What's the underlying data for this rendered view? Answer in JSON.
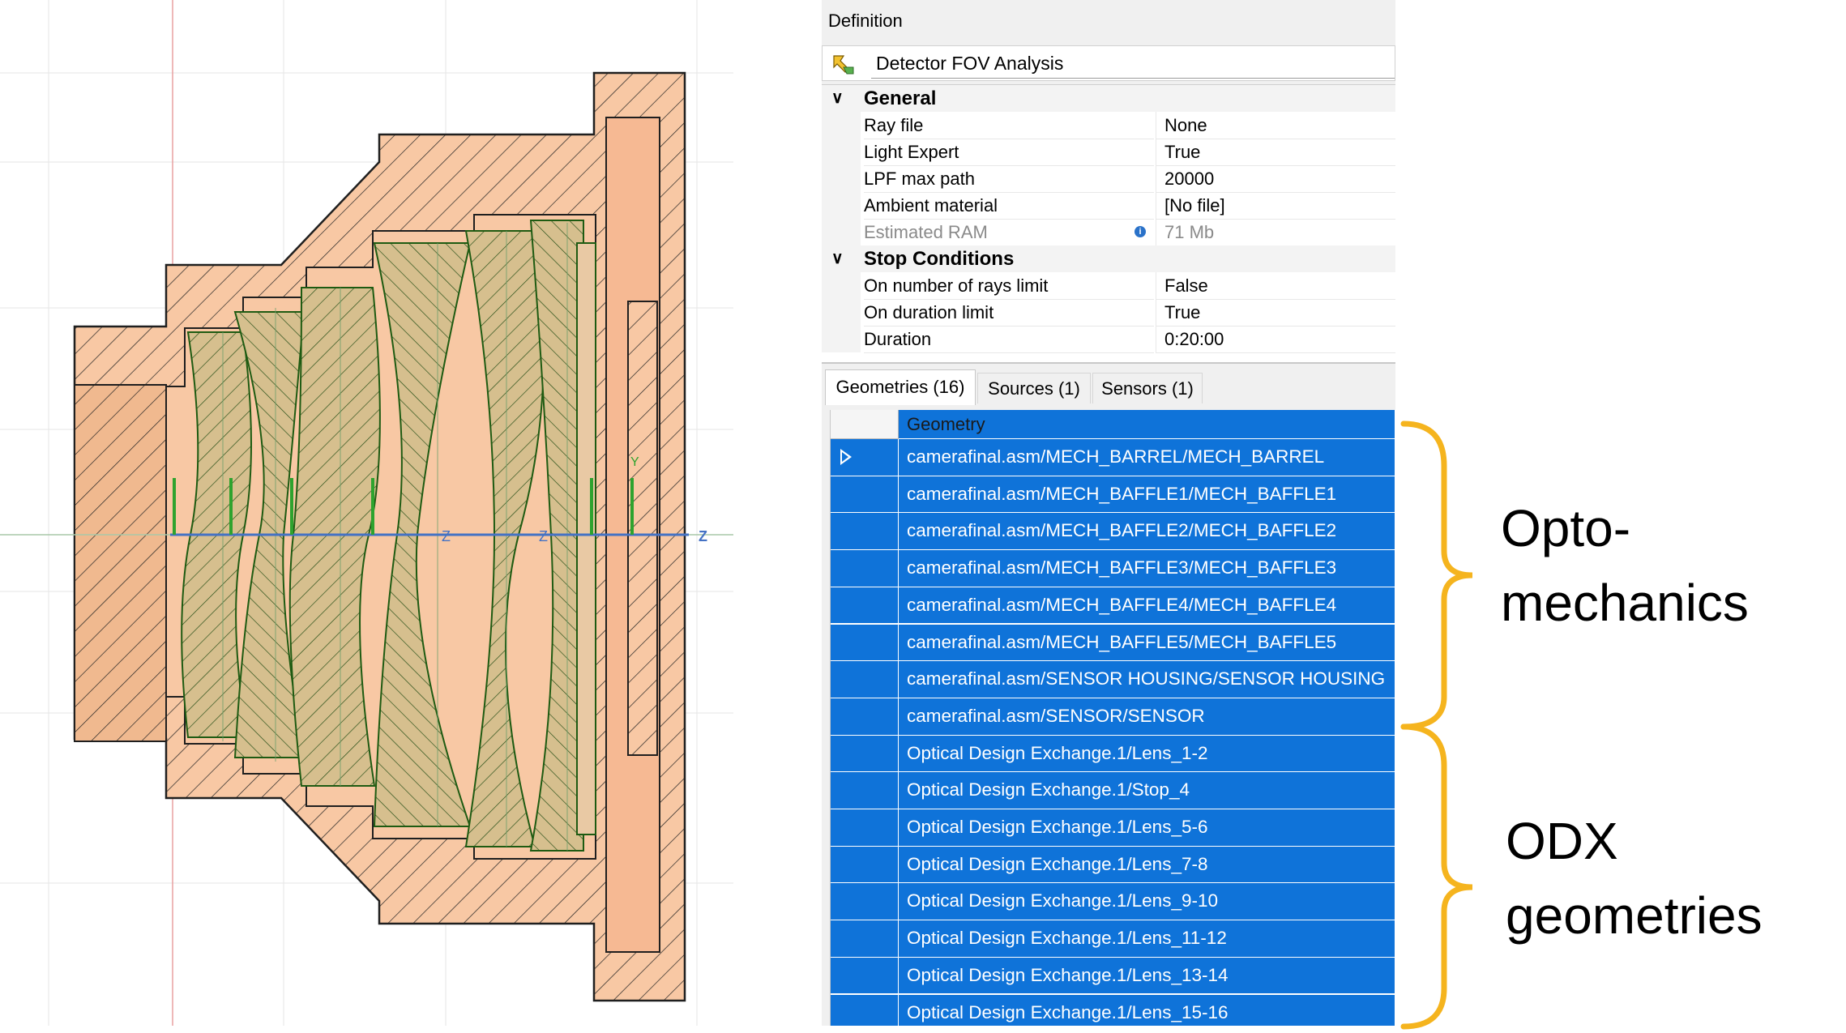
{
  "definition": {
    "header": "Definition",
    "name": "Detector FOV Analysis",
    "name_icon": "analysis-icon"
  },
  "general": {
    "label": "General",
    "rows": [
      {
        "name": "Ray file",
        "value": "None"
      },
      {
        "name": "Light Expert",
        "value": "True"
      },
      {
        "name": "LPF max path",
        "value": "20000"
      },
      {
        "name": "Ambient material",
        "value": "[No file]"
      },
      {
        "name": "Estimated RAM",
        "value": "71 Mb",
        "disabled": true
      }
    ]
  },
  "stop_conditions": {
    "label": "Stop Conditions",
    "rows": [
      {
        "name": "On number of rays limit",
        "value": "False"
      },
      {
        "name": "On duration limit",
        "value": "True"
      },
      {
        "name": "Duration",
        "value": "0:20:00"
      }
    ]
  },
  "tabs": [
    {
      "label": "Geometries (16)",
      "active": true
    },
    {
      "label": "Sources (1)",
      "active": false
    },
    {
      "label": "Sensors (1)",
      "active": false
    }
  ],
  "grid": {
    "column_header": "Geometry",
    "rows": [
      "camerafinal.asm/MECH_BARREL/MECH_BARREL",
      "camerafinal.asm/MECH_BAFFLE1/MECH_BAFFLE1",
      "camerafinal.asm/MECH_BAFFLE2/MECH_BAFFLE2",
      "camerafinal.asm/MECH_BAFFLE3/MECH_BAFFLE3",
      "camerafinal.asm/MECH_BAFFLE4/MECH_BAFFLE4",
      "camerafinal.asm/MECH_BAFFLE5/MECH_BAFFLE5",
      "camerafinal.asm/SENSOR HOUSING/SENSOR HOUSING",
      "camerafinal.asm/SENSOR/SENSOR",
      "Optical Design Exchange.1/Lens_1-2",
      "Optical Design Exchange.1/Stop_4",
      "Optical Design Exchange.1/Lens_5-6",
      "Optical Design Exchange.1/Lens_7-8",
      "Optical Design Exchange.1/Lens_9-10",
      "Optical Design Exchange.1/Lens_11-12",
      "Optical Design Exchange.1/Lens_13-14",
      "Optical Design Exchange.1/Lens_15-16"
    ]
  },
  "annotations": {
    "opto_line1": "Opto-",
    "opto_line2": "mechanics",
    "odx_line1": "ODX",
    "odx_line2": "geometries"
  },
  "viewport": {
    "axis_labels": [
      "Z",
      "Y"
    ],
    "colors": {
      "housing": "#f8c8a4",
      "lens": "#d9c58e",
      "outline": "#1f1f1f",
      "lens_outline": "#1e5b12",
      "axis": "#4472c4",
      "y_axis": "#2ea32e"
    }
  },
  "colors": {
    "selection": "#0f73d9",
    "brace": "#f5b41e"
  }
}
